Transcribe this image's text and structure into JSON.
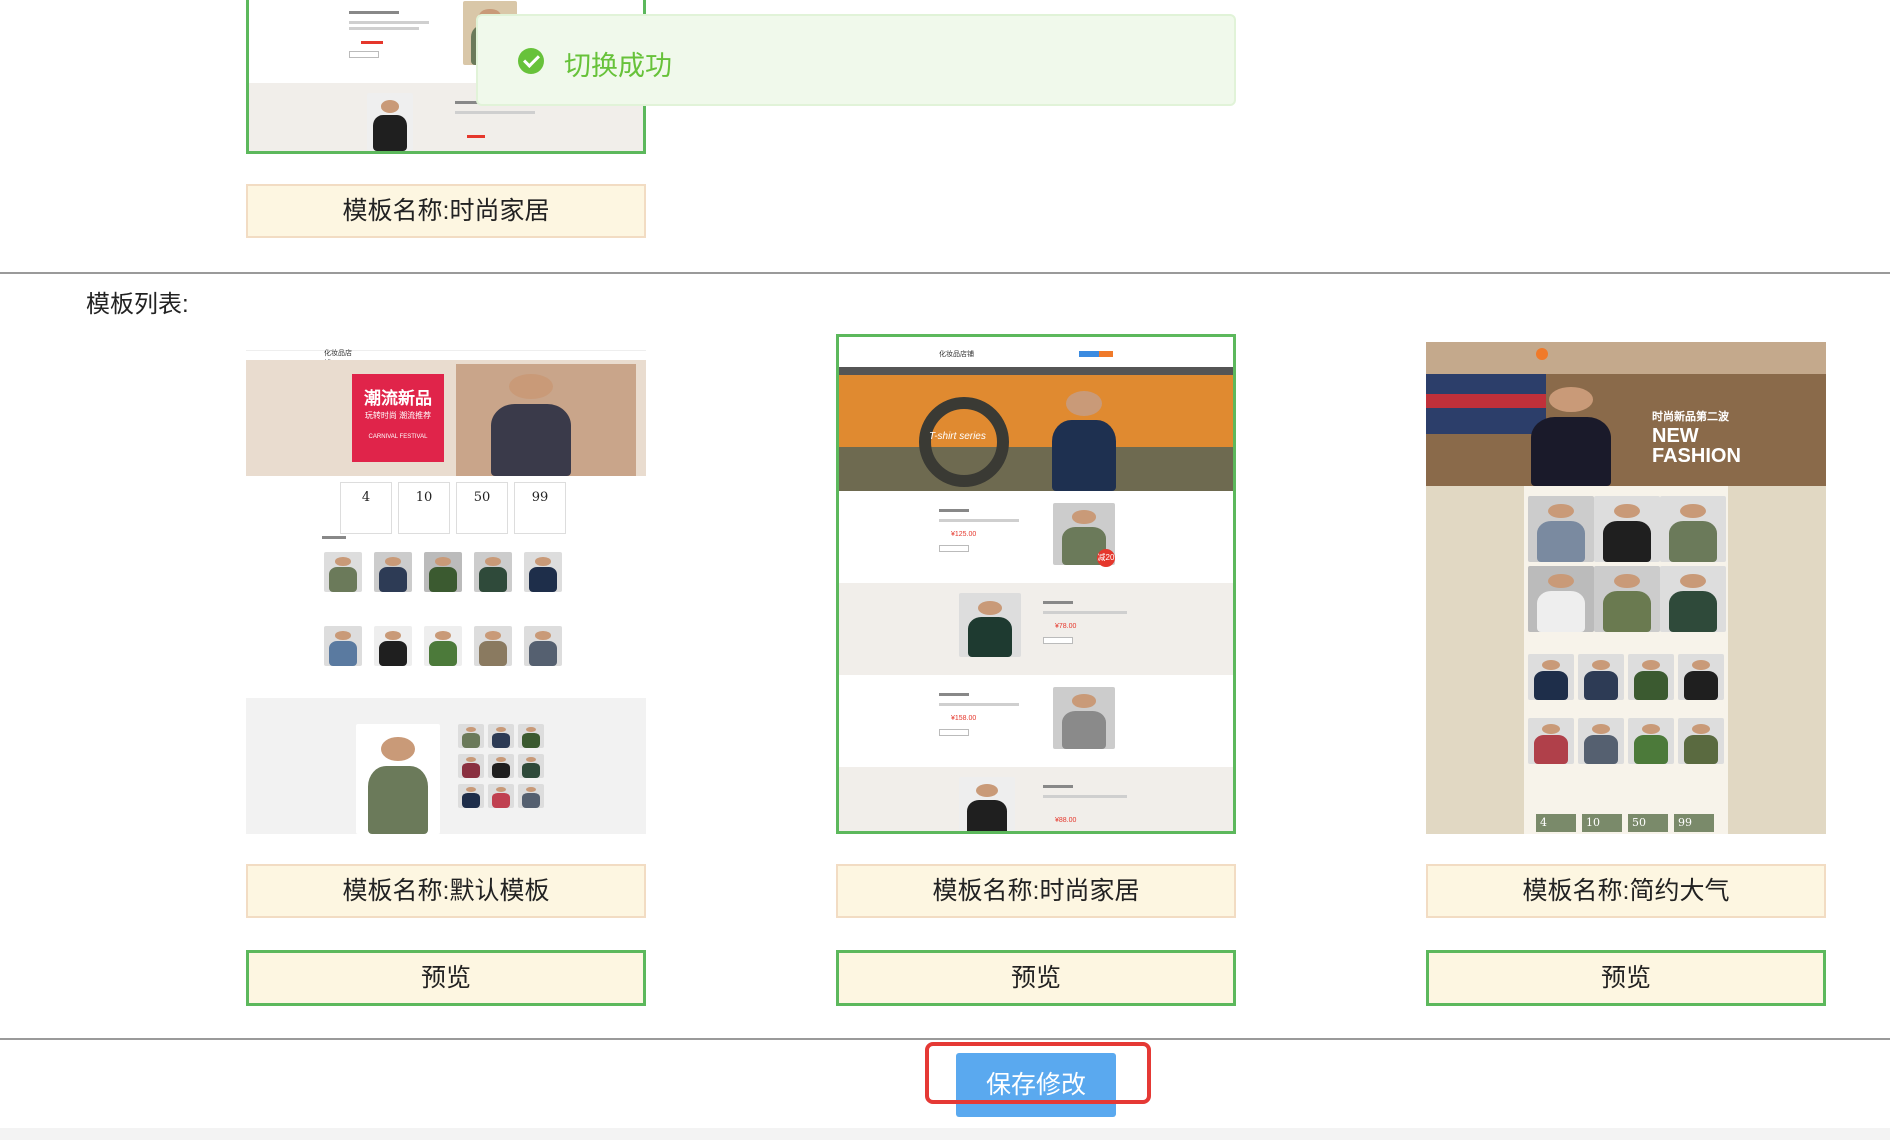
{
  "toast": {
    "message": "切换成功",
    "icon": "check-circle-icon",
    "color": "#67c23a"
  },
  "current_template": {
    "name_label": "模板名称:时尚家居"
  },
  "template_list": {
    "label": "模板列表:",
    "items": [
      {
        "name_label": "模板名称:默认模板",
        "preview_label": "预览",
        "selected": false,
        "banner_title": "潮流新品",
        "banner_sub": "玩转时尚 潮流推荐",
        "banner_en": "CARNIVAL FESTIVAL",
        "shop_name": "化妆品店铺",
        "stats": [
          "4",
          "10",
          "50",
          "99"
        ]
      },
      {
        "name_label": "模板名称:时尚家居",
        "preview_label": "预览",
        "selected": true,
        "shop_name": "化妆品店铺",
        "banner_text": "T-shirt series",
        "price_samples": [
          "¥125.00",
          "¥78.00",
          "¥158.00",
          "¥88.00"
        ],
        "tag_text": "减20"
      },
      {
        "name_label": "模板名称:简约大气",
        "preview_label": "预览",
        "selected": false,
        "banner_cn": "时尚新品第二波",
        "banner_en_1": "NEW",
        "banner_en_2": "FASHION",
        "stats": [
          "4",
          "10",
          "50",
          "99"
        ]
      }
    ]
  },
  "actions": {
    "save_label": "保存修改"
  },
  "colors": {
    "accent_green": "#5cb85c",
    "save_blue": "#5aa9ef",
    "highlight_red": "#e53935",
    "label_bg": "#fdf6e1"
  }
}
